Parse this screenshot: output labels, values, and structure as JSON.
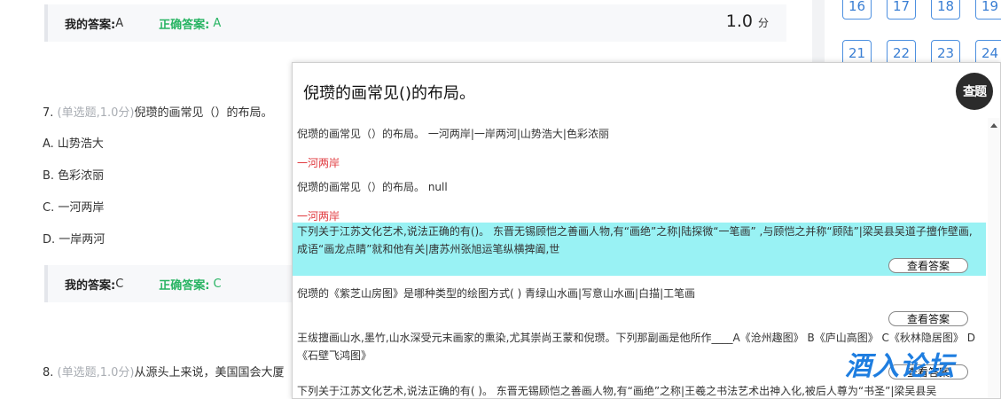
{
  "top_answer": {
    "my_label": "我的答案:",
    "my_value": "A",
    "correct_label": "正确答案:",
    "correct_value": "A",
    "score": "1.0",
    "score_unit": "分"
  },
  "question7": {
    "number": "7.",
    "meta": "(单选题,1.0分)",
    "text": "倪瓒的画常见（）的布局。",
    "options": [
      "A. 山势浩大",
      "B. 色彩浓丽",
      "C. 一河两岸",
      "D. 一岸两河"
    ]
  },
  "answer7": {
    "my_label": "我的答案:",
    "my_value": "C",
    "correct_label": "正确答案:",
    "correct_value": "C"
  },
  "question8": {
    "number": "8.",
    "meta": "(单选题,1.0分)",
    "text": "从源头上来说，美国国会大厦"
  },
  "sidebar": {
    "numbers": [
      "16",
      "17",
      "18",
      "19",
      "21",
      "22",
      "23",
      "24"
    ]
  },
  "popup": {
    "title": "倪瓒的画常见()的布局。",
    "lookup_button": "查题",
    "results": [
      {
        "question": "倪瓒的画常见（）的布局。 一河两岸|一岸两河|山势浩大|色彩浓丽",
        "answer": "一河两岸"
      },
      {
        "question": "倪瓒的画常见（）的布局。 null",
        "answer": "一河两岸"
      },
      {
        "question": "下列关于江苏文化艺术,说法正确的有()。 东晋无锡顾恺之善画人物,有“画绝”之称|陆探微“一笔画” ,与顾恺之并称“顾陆”|梁吴县吴道子擅作壁画,成语“画龙点睛”就和他有关|唐苏州张旭运笔纵横捭阖,世",
        "button": "查看答案"
      },
      {
        "question": "倪瓒的《紫芝山房图》是哪种类型的绘图方式( ) 青绿山水画|写意山水画|白描|工笔画",
        "button": "查看答案"
      },
      {
        "question": "王绂擅画山水,墨竹,山水深受元末画家的熏染,尤其崇尚王蒙和倪瓒。下列那副画是他所作____A《沧州趣图》 B《庐山高图》 C《秋林隐居图》 D《石壁飞鸿图》",
        "button": "查看答案"
      },
      {
        "question": "下列关于江苏文化艺术,说法正确的有( )。 东晋无锡顾恺之善画人物,有“画绝”之称|王羲之书法艺术出神入化,被后人尊为“书圣”|梁吴县吴"
      }
    ]
  },
  "watermark": "酒入论坛",
  "colors": {
    "correct": "#28b463",
    "answer_red": "#e0393e",
    "highlight": "#99f2f4",
    "number_blue": "#3a7fd4"
  }
}
